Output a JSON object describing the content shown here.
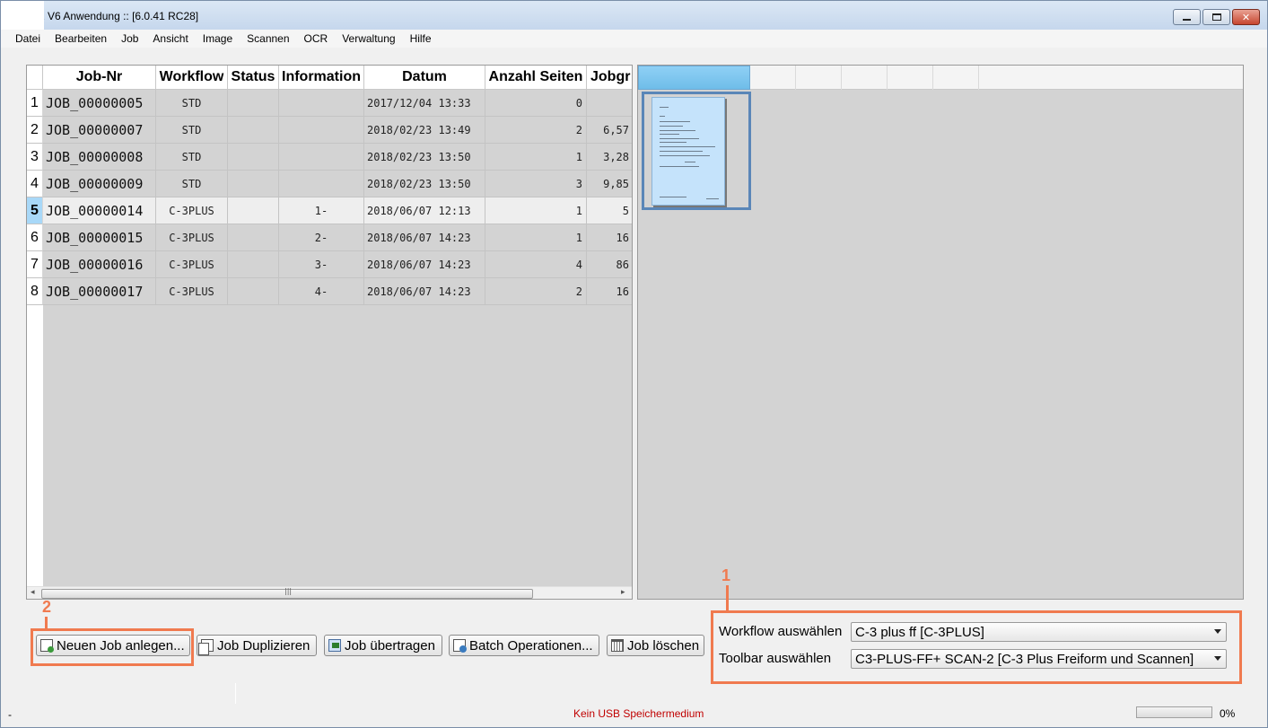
{
  "window": {
    "title": "S-2 V6 Anwendung :: [6.0.41 RC28]"
  },
  "menu": [
    "Datei",
    "Bearbeiten",
    "Job",
    "Ansicht",
    "Image",
    "Scannen",
    "OCR",
    "Verwaltung",
    "Hilfe"
  ],
  "table": {
    "columns": [
      "Job-Nr",
      "Workflow",
      "Status",
      "Information",
      "Datum",
      "Anzahl Seiten",
      "Jobgr"
    ],
    "rows": [
      {
        "num": "1",
        "job": "JOB_00000005",
        "workflow": "STD",
        "status": "",
        "info": "",
        "date": "2017/12/04 13:33",
        "pages": "0",
        "size": ""
      },
      {
        "num": "2",
        "job": "JOB_00000007",
        "workflow": "STD",
        "status": "",
        "info": "",
        "date": "2018/02/23 13:49",
        "pages": "2",
        "size": "6,57"
      },
      {
        "num": "3",
        "job": "JOB_00000008",
        "workflow": "STD",
        "status": "",
        "info": "",
        "date": "2018/02/23 13:50",
        "pages": "1",
        "size": "3,28"
      },
      {
        "num": "4",
        "job": "JOB_00000009",
        "workflow": "STD",
        "status": "",
        "info": "",
        "date": "2018/02/23 13:50",
        "pages": "3",
        "size": "9,85"
      },
      {
        "num": "5",
        "job": "JOB_00000014",
        "workflow": "C-3PLUS",
        "status": "",
        "info": "1-",
        "date": "2018/06/07 12:13",
        "pages": "1",
        "size": "5"
      },
      {
        "num": "6",
        "job": "JOB_00000015",
        "workflow": "C-3PLUS",
        "status": "",
        "info": "2-",
        "date": "2018/06/07 14:23",
        "pages": "1",
        "size": "16"
      },
      {
        "num": "7",
        "job": "JOB_00000016",
        "workflow": "C-3PLUS",
        "status": "",
        "info": "3-",
        "date": "2018/06/07 14:23",
        "pages": "4",
        "size": "86"
      },
      {
        "num": "8",
        "job": "JOB_00000017",
        "workflow": "C-3PLUS",
        "status": "",
        "info": "4-",
        "date": "2018/06/07 14:23",
        "pages": "2",
        "size": "16"
      }
    ],
    "selected_row": "5"
  },
  "buttons": {
    "new_job": "Neuen Job anlegen...",
    "duplicate": "Job Duplizieren",
    "transfer": "Job übertragen",
    "batch": "Batch Operationen...",
    "delete": "Job löschen"
  },
  "workflow": {
    "workflow_label": "Workflow auswählen",
    "workflow_value": "C-3 plus ff [C-3PLUS]",
    "toolbar_label": "Toolbar auswählen",
    "toolbar_value": "C3-PLUS-FF+ SCAN-2 [C-3 Plus Freiform und Scannen]"
  },
  "annotations": {
    "one": "1",
    "two": "2",
    "color": "#f07a4f"
  },
  "status": {
    "left": "-",
    "message": "Kein USB Speichermedium",
    "progress_percent": 0,
    "percent_label": "0%"
  }
}
